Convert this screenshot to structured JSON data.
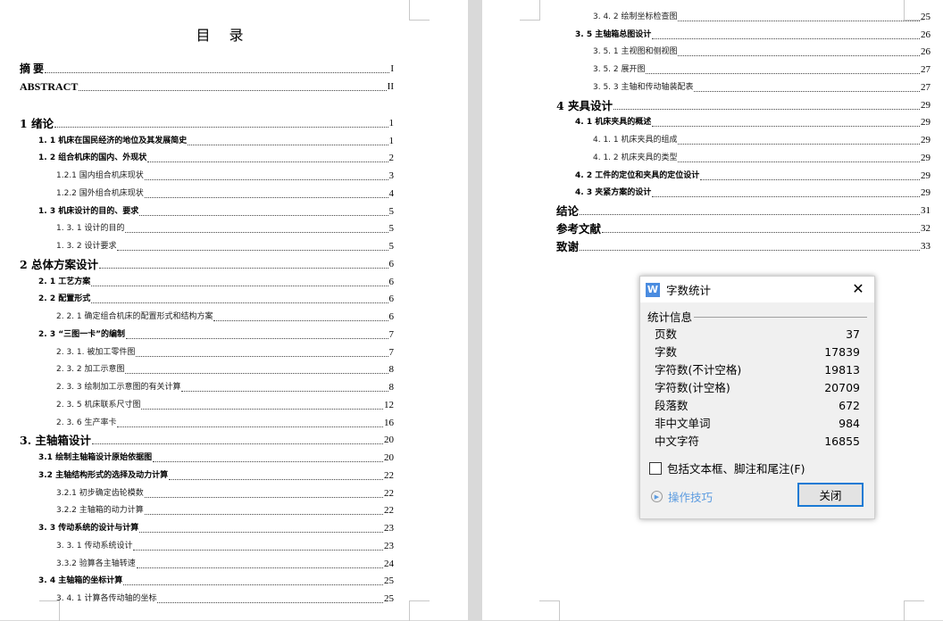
{
  "toc_title": "目 录",
  "left_front": [
    {
      "label": "摘  要",
      "page": "I",
      "level": "lv0f"
    },
    {
      "label": "ABSTRACT",
      "page": "II",
      "level": "lv0f"
    }
  ],
  "left_body": [
    {
      "label": "1   绪论",
      "page": "1",
      "level": "lv0"
    },
    {
      "label": "1. 1   机床在国民经济的地位及其发展简史",
      "page": "1",
      "level": "lv1"
    },
    {
      "label": "1. 2   组合机床的国内、外现状",
      "page": "2",
      "level": "lv1"
    },
    {
      "label": "1.2.1    国内组合机床现状",
      "page": "3",
      "level": "lv2"
    },
    {
      "label": "1.2.2    国外组合机床现状",
      "page": "4",
      "level": "lv2"
    },
    {
      "label": "1. 3   机床设计的目的、要求",
      "page": "5",
      "level": "lv1"
    },
    {
      "label": "1. 3. 1    设计的目的",
      "page": "5",
      "level": "lv2"
    },
    {
      "label": "1. 3. 2    设计要求",
      "page": "5",
      "level": "lv2"
    },
    {
      "label": "2     总体方案设计",
      "page": "6",
      "level": "lv0"
    },
    {
      "label": "2. 1   工艺方案",
      "page": "6",
      "level": "lv1"
    },
    {
      "label": "2. 2   配置形式",
      "page": "6",
      "level": "lv1"
    },
    {
      "label": "2. 2. 1  确定组合机床的配置形式和结构方案",
      "page": "6",
      "level": "lv2"
    },
    {
      "label": "2. 3  “三图一卡”的编制",
      "page": "7",
      "level": "lv1"
    },
    {
      "label": "2. 3. 1. 被加工零件图",
      "page": "7",
      "level": "lv2"
    },
    {
      "label": "2. 3. 2  加工示意图",
      "page": "8",
      "level": "lv2"
    },
    {
      "label": "2. 3. 3  绘制加工示意图的有关计算",
      "page": "8",
      "level": "lv2"
    },
    {
      "label": "2. 3. 5  机床联系尺寸图",
      "page": "12",
      "level": "lv2"
    },
    {
      "label": "2. 3. 6  生产率卡",
      "page": "16",
      "level": "lv2"
    },
    {
      "label": "3.   主轴箱设计",
      "page": "20",
      "level": "lv0"
    },
    {
      "label": "3.1    绘制主轴箱设计原始依据图",
      "page": "20",
      "level": "lv1"
    },
    {
      "label": "3.2 主轴结构形式的选择及动力计算",
      "page": "22",
      "level": "lv1"
    },
    {
      "label": "3.2.1 初步确定齿轮模数",
      "page": "22",
      "level": "lv2"
    },
    {
      "label": "3.2.2 主轴箱的动力计算",
      "page": "22",
      "level": "lv2"
    },
    {
      "label": "3. 3 传动系统的设计与计算",
      "page": "23",
      "level": "lv1"
    },
    {
      "label": "3. 3. 1  传动系统设计",
      "page": "23",
      "level": "lv2"
    },
    {
      "label": "3.3.2  验算各主轴转速",
      "page": "24",
      "level": "lv2"
    },
    {
      "label": "3. 4 主轴箱的坐标计算",
      "page": "25",
      "level": "lv1"
    },
    {
      "label": "3. 4. 1  计算各传动轴的坐标",
      "page": "25",
      "level": "lv2"
    }
  ],
  "right_body": [
    {
      "label": "3. 4. 2 绘制坐标检查图",
      "page": "25",
      "level": "lv2"
    },
    {
      "label": "3. 5  主轴箱总图设计",
      "page": "26",
      "level": "lv1"
    },
    {
      "label": "3. 5. 1  主视图和侧视图",
      "page": "26",
      "level": "lv2"
    },
    {
      "label": "3. 5. 2  展开图",
      "page": "27",
      "level": "lv2"
    },
    {
      "label": "3. 5. 3 主轴和传动轴装配表",
      "page": "27",
      "level": "lv2"
    },
    {
      "label": "4   夹具设计",
      "page": "29",
      "level": "lv0"
    },
    {
      "label": "4. 1   机床夹具的概述",
      "page": "29",
      "level": "lv1"
    },
    {
      "label": "4. 1. 1  机床夹具的组成",
      "page": "29",
      "level": "lv2"
    },
    {
      "label": "4. 1. 2  机床夹具的类型",
      "page": "29",
      "level": "lv2"
    },
    {
      "label": "4. 2   工件的定位和夹具的定位设计",
      "page": "29",
      "level": "lv1"
    },
    {
      "label": "4. 3   夹紧方案的设计",
      "page": "29",
      "level": "lv1"
    },
    {
      "label": "结论",
      "page": "31",
      "level": "lv0"
    },
    {
      "label": "参考文献",
      "page": "32",
      "level": "lv0"
    },
    {
      "label": "致谢",
      "page": "33",
      "level": "lv0"
    }
  ],
  "dialog": {
    "title": "字数统计",
    "app_icon_letter": "W",
    "close_glyph": "✕",
    "group_label": "统计信息",
    "stats": [
      {
        "label": "页数",
        "value": "37"
      },
      {
        "label": "字数",
        "value": "17839"
      },
      {
        "label": "字符数(不计空格)",
        "value": "19813"
      },
      {
        "label": "字符数(计空格)",
        "value": "20709"
      },
      {
        "label": "段落数",
        "value": "672"
      },
      {
        "label": "非中文单词",
        "value": "984"
      },
      {
        "label": "中文字符",
        "value": "16855"
      }
    ],
    "checkbox_label": "包括文本框、脚注和尾注(F)",
    "checkbox_checked": false,
    "tips_label": "操作技巧",
    "close_button": "关闭",
    "accent_color": "#1a7ad4"
  }
}
